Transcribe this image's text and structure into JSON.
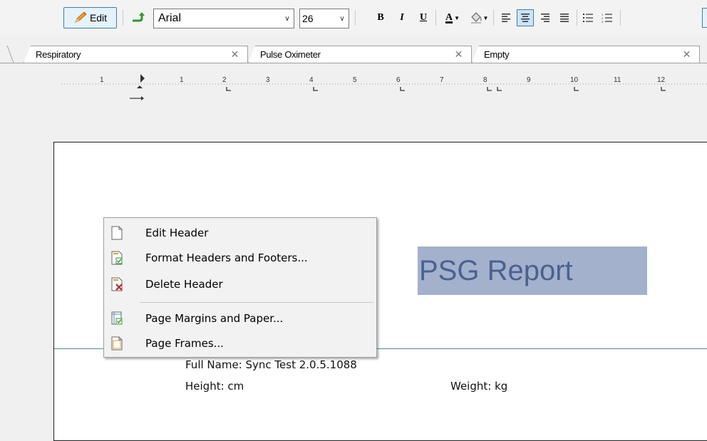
{
  "toolbar": {
    "edit_label": "Edit",
    "font_name": "Arial",
    "font_size": "26",
    "bold": "B",
    "italic": "I",
    "underline": "U",
    "font_color": "A"
  },
  "tabs": [
    {
      "label": "Respiratory"
    },
    {
      "label": "Pulse Oximeter"
    },
    {
      "label": "Empty"
    }
  ],
  "ruler": {
    "labels": [
      "1",
      "1",
      "2",
      "3",
      "4",
      "5",
      "6",
      "7",
      "8",
      "9",
      "10",
      "11",
      "12"
    ]
  },
  "document": {
    "title": "PSG Report",
    "full_name": "Full Name: Sync Test 2.0.5.1088",
    "height": "Height: cm",
    "weight": "Weight: kg"
  },
  "context_menu": {
    "items": [
      {
        "label": "Edit Header",
        "icon": "page-icon"
      },
      {
        "label": "Format Headers and Footers...",
        "icon": "format-header-icon"
      },
      {
        "label": "Delete Header",
        "icon": "delete-header-icon"
      },
      {
        "label": "Page Margins and Paper...",
        "icon": "page-margins-icon"
      },
      {
        "label": "Page Frames...",
        "icon": "page-frames-icon"
      }
    ]
  },
  "colors": {
    "title_text": "#4a6291",
    "selection": "#a3b1cc",
    "header_line": "#4e8bc4",
    "active_button": "#3c7fb1"
  }
}
